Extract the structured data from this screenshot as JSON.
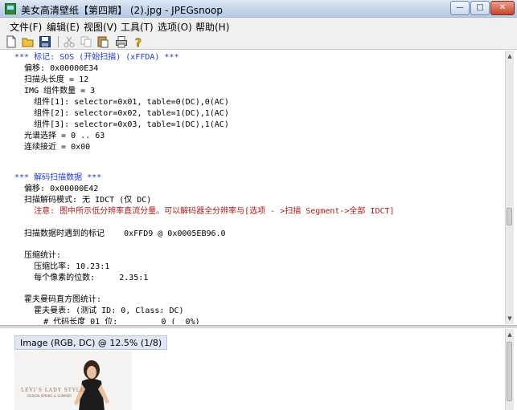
{
  "window": {
    "title": "美女高清壁纸【第四期】 (2).jpg - JPEGsnoop",
    "min_glyph": "—",
    "max_glyph": "□",
    "close_glyph": "✕"
  },
  "menu": [
    "文件(F)",
    "编辑(E)",
    "视图(V)",
    "工具(T)",
    "选项(O)",
    "帮助(H)"
  ],
  "toolbar_icons": [
    "new-icon",
    "open-icon",
    "save-icon",
    "cut-icon",
    "copy-icon",
    "paste-icon",
    "print-icon",
    "help-icon"
  ],
  "log": [
    {
      "text": "*** 标记: SOS (开始扫描) (xFFDA) ***",
      "style": "blue"
    },
    {
      "text": "  偏移: 0x00000E34",
      "style": ""
    },
    {
      "text": "  扫描头长度 = 12",
      "style": ""
    },
    {
      "text": "  IMG 组件数量 = 3",
      "style": ""
    },
    {
      "text": "    组件[1]: selector=0x01, table=0(DC),0(AC)",
      "style": ""
    },
    {
      "text": "    组件[2]: selector=0x02, table=1(DC),1(AC)",
      "style": ""
    },
    {
      "text": "    组件[3]: selector=0x03, table=1(DC),1(AC)",
      "style": ""
    },
    {
      "text": "  光谱选择 = 0 .. 63",
      "style": ""
    },
    {
      "text": "  连续接近 = 0x00",
      "style": ""
    },
    {
      "text": "",
      "style": ""
    },
    {
      "text": "",
      "style": ""
    },
    {
      "text": "*** 解码扫描数据 ***",
      "style": "blue"
    },
    {
      "text": "  偏移: 0x00000E42",
      "style": ""
    },
    {
      "text": "  扫描解码模式: 无 IDCT (仅 DC)",
      "style": ""
    },
    {
      "text": "    注意: 图中所示低分辨率直流分量。可以解码器全分辨率与[选项 - >扫描 Segment->全部 IDCT]",
      "style": "red"
    },
    {
      "text": "",
      "style": ""
    },
    {
      "text": "",
      "style": ""
    },
    {
      "text": "  扫描数据时遇到的标记    0xFFD9 @ 0x0005EB96.0",
      "style": ""
    },
    {
      "text": "",
      "style": ""
    },
    {
      "text": "",
      "style": ""
    },
    {
      "text": "  压缩统计:",
      "style": ""
    },
    {
      "text": "    压缩比率: 10.23:1",
      "style": ""
    },
    {
      "text": "    每个像素的位数:     2.35:1",
      "style": ""
    },
    {
      "text": "",
      "style": ""
    },
    {
      "text": "",
      "style": ""
    },
    {
      "text": "  霍夫曼码直方图统计:",
      "style": ""
    },
    {
      "text": "    霍夫曼表: (测试 ID: 0, Class: DC)",
      "style": ""
    },
    {
      "text": "      # 代码长度 01 位:         0 (  0%)",
      "style": ""
    }
  ],
  "image_panel": {
    "caption": "Image (RGB, DC) @ 12.5% (1/8)",
    "thumb_text": "LEVI'S LADY STYLE",
    "thumb_subtext": "DESIGN SPRING & SUMMER"
  },
  "colors": {
    "heading_blue": "#1f3bd0",
    "note_red": "#b01818"
  }
}
